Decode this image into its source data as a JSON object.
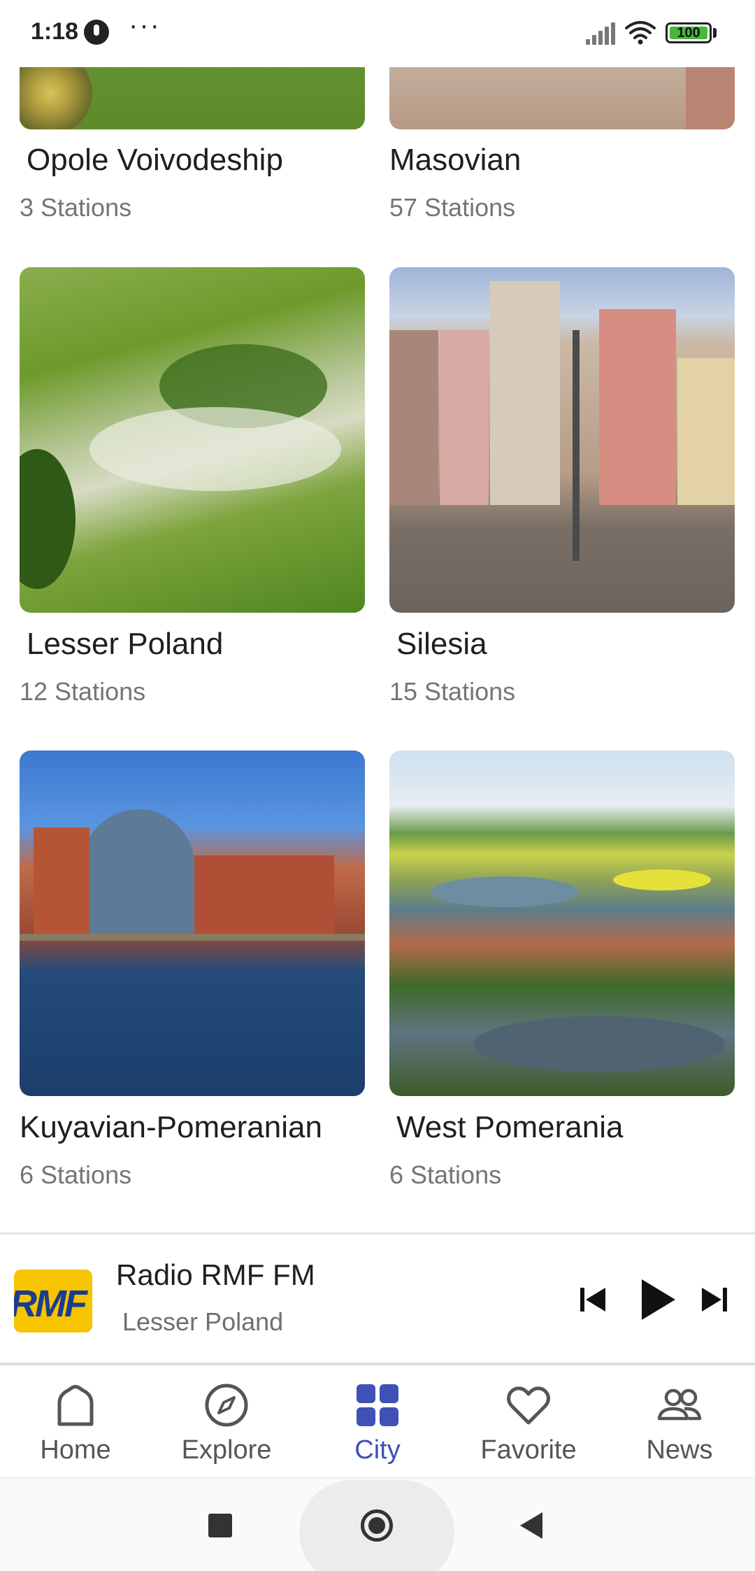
{
  "status_bar": {
    "time": "1:18",
    "dots": "···",
    "battery": "100"
  },
  "regions": [
    {
      "name": "Opole Voivodeship",
      "count": "3 Stations",
      "image": "green-field"
    },
    {
      "name": "Masovian",
      "count": "57 Stations",
      "image": "city-square"
    },
    {
      "name": "Lesser Poland",
      "count": "12 Stations",
      "image": "misty-hills"
    },
    {
      "name": "Silesia",
      "count": "15 Stations",
      "image": "old-town-facades"
    },
    {
      "name": "Kuyavian-Pomeranian",
      "count": "6 Stations",
      "image": "riverside-buildings"
    },
    {
      "name": "West Pomerania",
      "count": "6 Stations",
      "image": "lakeside-town-aerial"
    }
  ],
  "player": {
    "logo_text": "RMF",
    "station": "Radio RMF FM",
    "region": "Lesser Poland",
    "colors": {
      "logo_bg": "#f6c400",
      "logo_text": "#1a3d8f"
    }
  },
  "bottom_nav": {
    "items": [
      {
        "label": "Home",
        "icon": "home-icon"
      },
      {
        "label": "Explore",
        "icon": "compass-icon"
      },
      {
        "label": "City",
        "icon": "grid-icon"
      },
      {
        "label": "Favorite",
        "icon": "heart-icon"
      },
      {
        "label": "News",
        "icon": "people-icon"
      }
    ],
    "active": "City",
    "colors": {
      "active": "#3f51b5",
      "inactive": "#555555"
    }
  }
}
